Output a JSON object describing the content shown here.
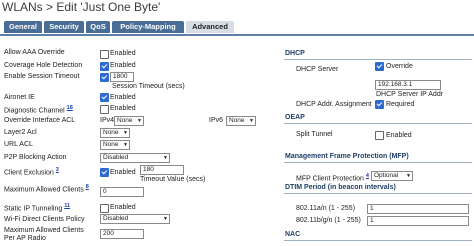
{
  "title": "WLANs > Edit  'Just One Byte'",
  "tabs": [
    "General",
    "Security",
    "QoS",
    "Policy-Mapping",
    "Advanced"
  ],
  "left": {
    "allow_aaa": {
      "label": "Allow AAA Override",
      "checked": false,
      "text": "Enabled"
    },
    "coverage": {
      "label": "Coverage Hole Detection",
      "checked": true,
      "text": "Enabled"
    },
    "session": {
      "label": "Enable Session Timeout",
      "checked": true,
      "value": "1800",
      "sub": "Session Timeout (secs)"
    },
    "aironet": {
      "label": "Aironet IE",
      "checked": true,
      "text": "Enabled"
    },
    "diag": {
      "label": "Diagnostic Channel",
      "link": "18",
      "checked": false,
      "text": "Enabled"
    },
    "override_acl": {
      "label": "Override Interface ACL",
      "ipv4_label": "IPv4",
      "ipv4_value": "None",
      "ipv6_label": "IPv6",
      "ipv6_value": "None"
    },
    "layer2_acl": {
      "label": "Layer2 Acl",
      "value": "None"
    },
    "url_acl": {
      "label": "URL ACL",
      "value": "None"
    },
    "p2p": {
      "label": "P2P Blocking Action",
      "value": "Disabled"
    },
    "client_excl": {
      "label": "Client Exclusion",
      "link": "3",
      "checked": true,
      "value": "180",
      "sub": "Timeout Value (secs)"
    },
    "max_clients": {
      "label": "Maximum Allowed Clients",
      "link": "8",
      "value": "0"
    },
    "static_ip": {
      "label": "Static IP Tunneling",
      "link": "11",
      "checked": false,
      "text": "Enabled"
    },
    "wifi_direct": {
      "label": "Wi-Fi Direct Clients Policy",
      "value": "Disabled"
    },
    "max_per_ap": {
      "label": "Maximum Allowed Clients Per AP Radio",
      "value": "200"
    }
  },
  "right": {
    "dhcp_section": "DHCP",
    "dhcp_server": {
      "label": "DHCP Server",
      "checked": true,
      "text": "Override"
    },
    "dhcp_ip": {
      "value": "192.168.3.1",
      "sub": "DHCP Server IP Addr"
    },
    "dhcp_assign": {
      "label": "DHCP Addr. Assignment",
      "checked": true,
      "text": "Required"
    },
    "oeap_section": "OEAP",
    "split": {
      "label": "Split Tunnel",
      "checked": false,
      "text": "Enabled"
    },
    "mfp_section": "Management Frame Protection (MFP)",
    "mfp": {
      "label": "MFP Client Protection",
      "link": "4",
      "value": "Optional"
    },
    "dtim_section": "DTIM Period (in beacon intervals)",
    "dtim_a": {
      "label": "802.11a/n (1 - 255)",
      "value": "1"
    },
    "dtim_b": {
      "label": "802.11b/g/n (1 - 255)",
      "value": "1"
    },
    "nac_section": "NAC"
  }
}
